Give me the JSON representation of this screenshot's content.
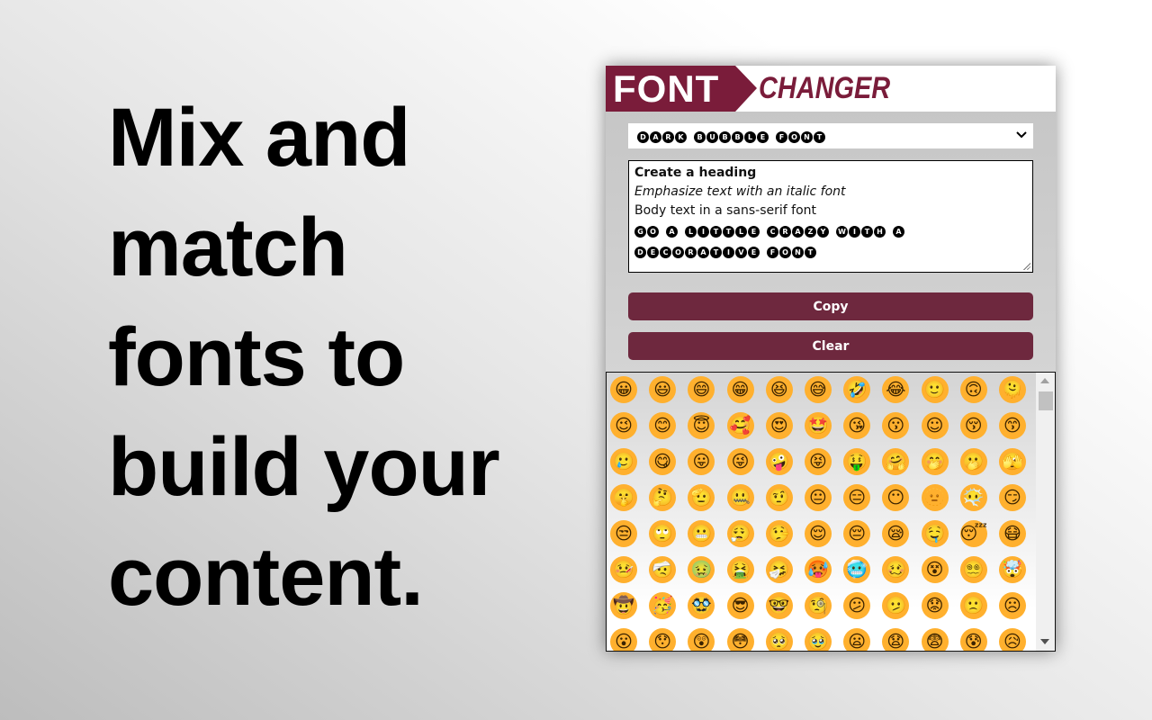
{
  "hero": {
    "lines": [
      "Mix and",
      "match",
      "fonts to",
      "build your",
      "content."
    ]
  },
  "logo": {
    "font": "FONT",
    "changer": "CHANGER"
  },
  "colors": {
    "brand": "#7a1c3a",
    "button": "#6e283e",
    "emoji": "#ffb02e"
  },
  "font_select": {
    "value": "DARK BUBBLE FONT",
    "icon": "chevron-down-icon"
  },
  "editor": {
    "heading": "Create a heading",
    "italic": "Emphasize text with an italic font",
    "body": "Body text in a sans-serif font",
    "decorative1": "GO A LITTLE CRAZY WITH A",
    "decorative2": "DECORATIVE FONT"
  },
  "buttons": {
    "copy": "Copy",
    "clear": "Clear"
  },
  "emojis": [
    "😀",
    "😃",
    "😄",
    "😁",
    "😆",
    "😅",
    "🤣",
    "😂",
    "🙂",
    "🙃",
    "🫠",
    "😉",
    "😊",
    "😇",
    "🥰",
    "😍",
    "🤩",
    "😘",
    "😗",
    "☺",
    "😚",
    "😙",
    "🥲",
    "😋",
    "😛",
    "😜",
    "🤪",
    "😝",
    "🤑",
    "🤗",
    "🤭",
    "🫢",
    "🫣",
    "🤫",
    "🤔",
    "🫡",
    "🤐",
    "🤨",
    "😐",
    "😑",
    "😶",
    "🫥",
    "😶‍🌫️",
    "😏",
    "😒",
    "🙄",
    "😬",
    "😮‍💨",
    "🤥",
    "😌",
    "😔",
    "😪",
    "🤤",
    "😴",
    "😷",
    "🤒",
    "🤕",
    "🤢",
    "🤮",
    "🤧",
    "🥵",
    "🥶",
    "🥴",
    "😵",
    "😵‍💫",
    "🤯",
    "🤠",
    "🥳",
    "🥸",
    "😎",
    "🤓",
    "🧐",
    "😕",
    "🫤",
    "😟",
    "🙁",
    "☹",
    "😮",
    "😯",
    "😲",
    "😳",
    "🥺",
    "🥹",
    "😦",
    "😧",
    "😨",
    "😰",
    "😥"
  ]
}
